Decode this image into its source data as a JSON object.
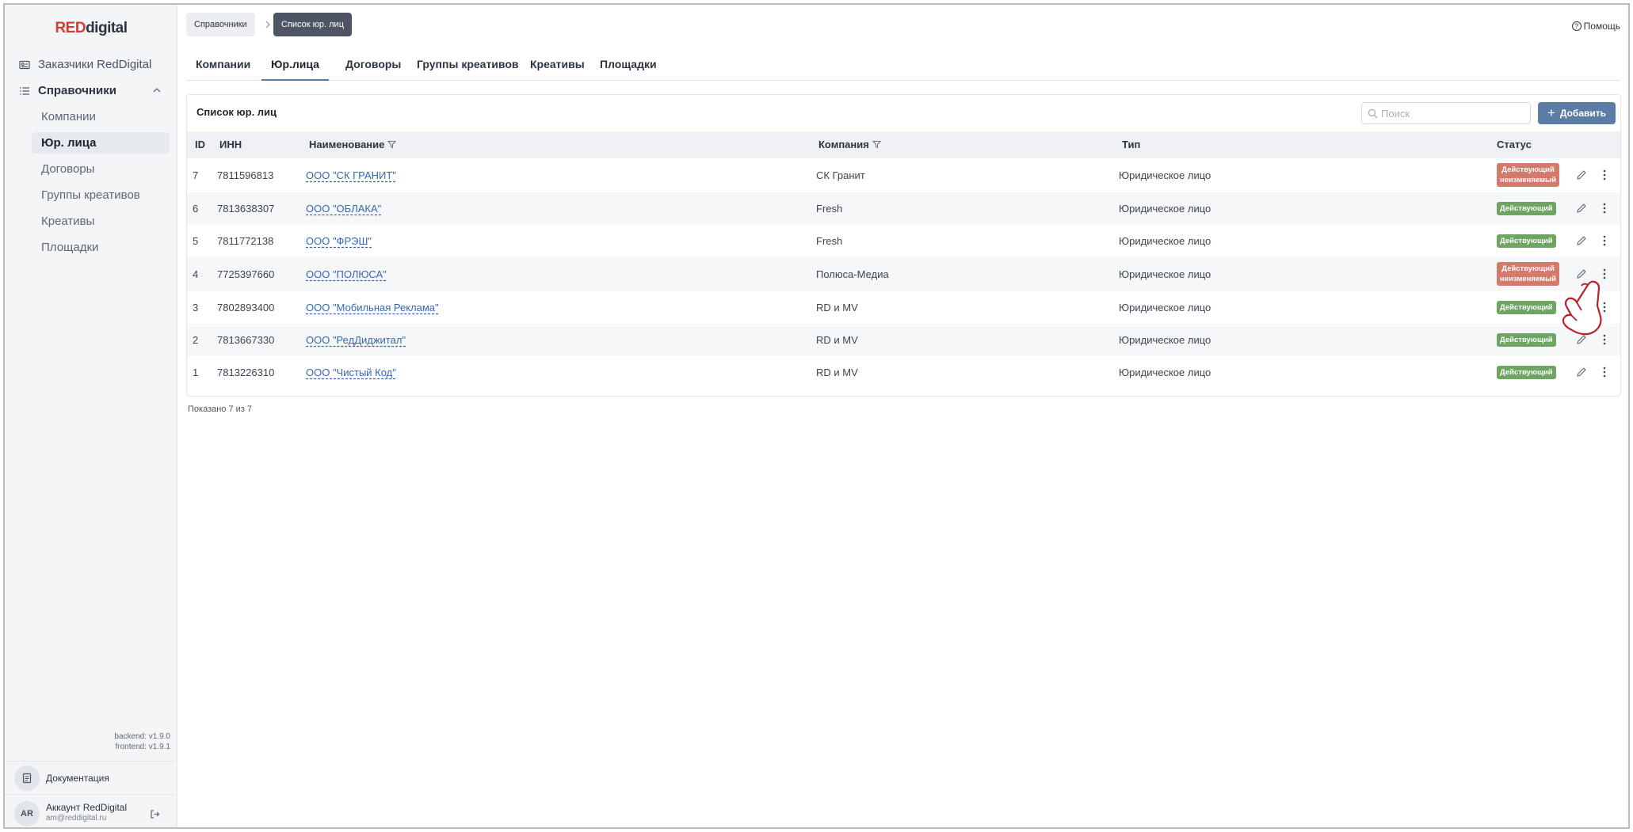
{
  "brand": {
    "part1": "RED",
    "part2": "digital"
  },
  "sidebar": {
    "customers": "Заказчики RedDigital",
    "directories": "Справочники",
    "items": [
      {
        "label": "Компании"
      },
      {
        "label": "Юр. лица"
      },
      {
        "label": "Договоры"
      },
      {
        "label": "Группы креативов"
      },
      {
        "label": "Креативы"
      },
      {
        "label": "Площадки"
      }
    ],
    "backend_version": "backend: v1.9.0",
    "frontend_version": "frontend: v1.9.1",
    "docs": "Документация",
    "account": {
      "initials": "AR",
      "name": "Аккаунт RedDigital",
      "email": "am@reddigital.ru"
    }
  },
  "breadcrumb": {
    "root": "Справочники",
    "current": "Список юр. лиц"
  },
  "help": "Помощь",
  "tabs": [
    {
      "label": "Компании"
    },
    {
      "label": "Юр.лица"
    },
    {
      "label": "Договоры"
    },
    {
      "label": "Группы креативов"
    },
    {
      "label": "Креативы"
    },
    {
      "label": "Площадки"
    }
  ],
  "panel": {
    "title": "Список юр. лиц",
    "search_placeholder": "Поиск",
    "add_label": "Добавить"
  },
  "table": {
    "headers": {
      "id": "ID",
      "inn": "ИНН",
      "name": "Наименование",
      "company": "Компания",
      "type": "Тип",
      "status": "Статус"
    },
    "rows": [
      {
        "id": "7",
        "inn": "7811596813",
        "name": "ООО \"СК ГРАНИТ\"",
        "company": "СК Гранит",
        "type": "Юридическое лицо",
        "status_line1": "Действующий",
        "status_line2": "неизменяемый"
      },
      {
        "id": "6",
        "inn": "7813638307",
        "name": "ООО \"ОБЛАКА\"",
        "company": "Fresh",
        "type": "Юридическое лицо",
        "status_line1": "Действующий"
      },
      {
        "id": "5",
        "inn": "7811772138",
        "name": "ООО \"ФРЭШ\"",
        "company": "Fresh",
        "type": "Юридическое лицо",
        "status_line1": "Действующий"
      },
      {
        "id": "4",
        "inn": "7725397660",
        "name": "ООО \"ПОЛЮСА\"",
        "company": "Полюса-Медиа",
        "type": "Юридическое лицо",
        "status_line1": "Действующий",
        "status_line2": "неизменяемый"
      },
      {
        "id": "3",
        "inn": "7802893400",
        "name": "ООО \"Мобильная Реклама\"",
        "company": "RD и MV",
        "type": "Юридическое лицо",
        "status_line1": "Действующий"
      },
      {
        "id": "2",
        "inn": "7813667330",
        "name": "ООО \"РедДиджитал\"",
        "company": "RD и MV",
        "type": "Юридическое лицо",
        "status_line1": "Действующий"
      },
      {
        "id": "1",
        "inn": "7813226310",
        "name": "ООО \"Чистый Код\"",
        "company": "RD и MV",
        "type": "Юридическое лицо",
        "status_line1": "Действующий"
      }
    ]
  },
  "footer": {
    "showing": "Показано 7 из 7"
  },
  "colors": {
    "accent": "#5a7ca5",
    "status_active": "#6ea563",
    "status_locked": "#d47a6a",
    "brand_red": "#d63a33"
  }
}
